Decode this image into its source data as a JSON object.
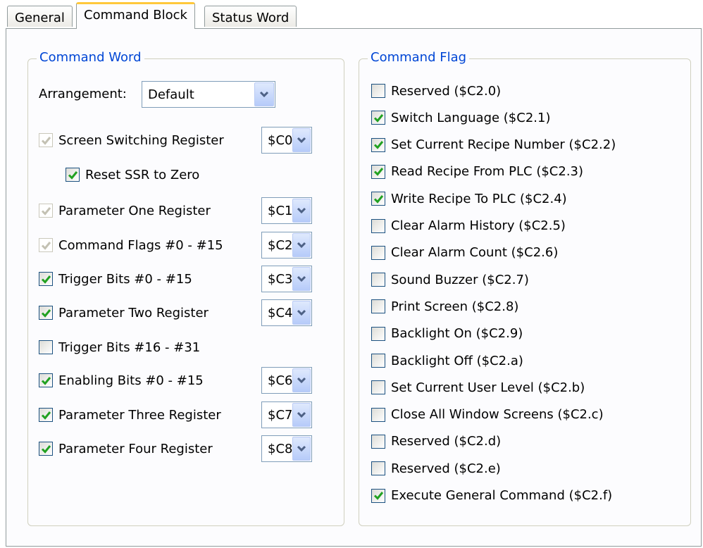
{
  "tabs": [
    {
      "label": "General"
    },
    {
      "label": "Command Block"
    },
    {
      "label": "Status Word"
    }
  ],
  "command_word": {
    "legend": "Command Word",
    "arrangement_label": "Arrangement:",
    "arrangement_value": "Default",
    "items": [
      {
        "label": "Screen Switching Register",
        "checked": true,
        "disabled": true,
        "register": "$C0"
      },
      {
        "label": "Reset SSR to Zero",
        "checked": true,
        "disabled": false
      },
      {
        "label": "Parameter One Register",
        "checked": true,
        "disabled": true,
        "register": "$C1"
      },
      {
        "label": "Command Flags #0 - #15",
        "checked": true,
        "disabled": true,
        "register": "$C2"
      },
      {
        "label": "Trigger Bits #0 - #15",
        "checked": true,
        "disabled": false,
        "register": "$C3"
      },
      {
        "label": "Parameter Two Register",
        "checked": true,
        "disabled": false,
        "register": "$C4"
      },
      {
        "label": "Trigger Bits #16 - #31",
        "checked": false,
        "disabled": false
      },
      {
        "label": "Enabling Bits #0 - #15",
        "checked": true,
        "disabled": false,
        "register": "$C6"
      },
      {
        "label": "Parameter Three Register",
        "checked": true,
        "disabled": false,
        "register": "$C7"
      },
      {
        "label": "Parameter Four Register",
        "checked": true,
        "disabled": false,
        "register": "$C8"
      }
    ]
  },
  "command_flag": {
    "legend": "Command Flag",
    "items": [
      {
        "label": "Reserved ($C2.0)",
        "checked": false
      },
      {
        "label": "Switch Language ($C2.1)",
        "checked": true
      },
      {
        "label": "Set Current Recipe Number ($C2.2)",
        "checked": true
      },
      {
        "label": "Read Recipe From PLC ($C2.3)",
        "checked": true
      },
      {
        "label": "Write Recipe To PLC ($C2.4)",
        "checked": true
      },
      {
        "label": "Clear Alarm History ($C2.5)",
        "checked": false
      },
      {
        "label": "Clear Alarm Count ($C2.6)",
        "checked": false
      },
      {
        "label": "Sound Buzzer ($C2.7)",
        "checked": false
      },
      {
        "label": "Print Screen ($C2.8)",
        "checked": false
      },
      {
        "label": "Backlight On ($C2.9)",
        "checked": false
      },
      {
        "label": "Backlight Off ($C2.a)",
        "checked": false
      },
      {
        "label": "Set Current User Level ($C2.b)",
        "checked": false
      },
      {
        "label": "Close All Window Screens ($C2.c)",
        "checked": false
      },
      {
        "label": "Reserved ($C2.d)",
        "checked": false
      },
      {
        "label": "Reserved ($C2.e)",
        "checked": false
      },
      {
        "label": "Execute General Command ($C2.f)",
        "checked": true
      }
    ]
  },
  "icons": {
    "check": "check-icon",
    "dropdown": "chevron-down-icon"
  },
  "colors": {
    "legend": "#0046d5",
    "check": "#21a121",
    "active_tab_accent": "#ffc83c"
  }
}
